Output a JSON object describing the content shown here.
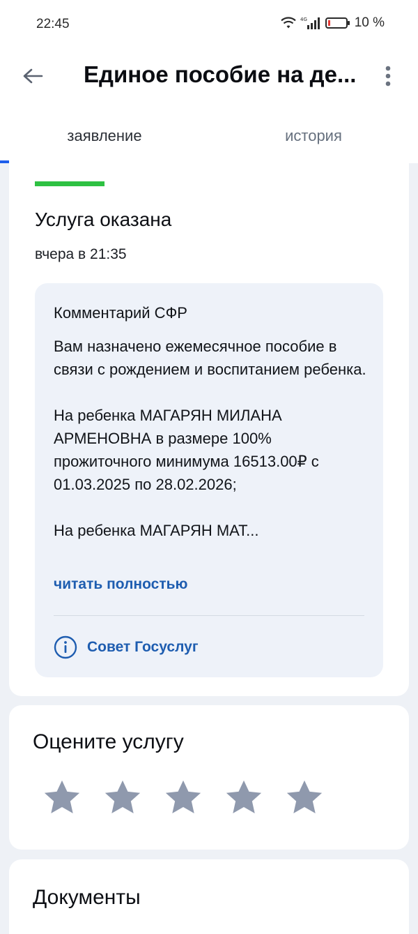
{
  "status_bar": {
    "time": "22:45",
    "battery": "10 %",
    "network_label": "4G"
  },
  "app_bar": {
    "title": "Единое пособие на де..."
  },
  "tabs": [
    {
      "label": "заявление",
      "active": true
    },
    {
      "label": "история",
      "active": false
    }
  ],
  "status_card": {
    "status": "Услуга оказана",
    "time": "вчера в 21:35",
    "status_color": "#2ec142",
    "comment": {
      "heading": "Комментарий СФР",
      "paragraphs": [
        "Вам назначено ежемесячное пособие в связи с рождением и воспитанием ребенка.",
        "На ребенка МАГАРЯН МИЛАНА АРМЕНОВНА в размере 100% прожиточного минимума 16513.00₽ с 01.03.2025 по 28.02.2026;",
        "На ребенка МАГАРЯН МАТ..."
      ],
      "read_more": "читать полностью",
      "tip_label": "Совет Госуслуг",
      "tip_icon": "info-icon"
    }
  },
  "rating_card": {
    "title": "Оцените услугу",
    "max_stars": 5,
    "selected_stars": 0,
    "star_color": "#8f99ad"
  },
  "documents_card": {
    "title": "Документы"
  },
  "colors": {
    "accent": "#1d5deb",
    "link": "#1e5db0",
    "background": "#eef1f6"
  }
}
